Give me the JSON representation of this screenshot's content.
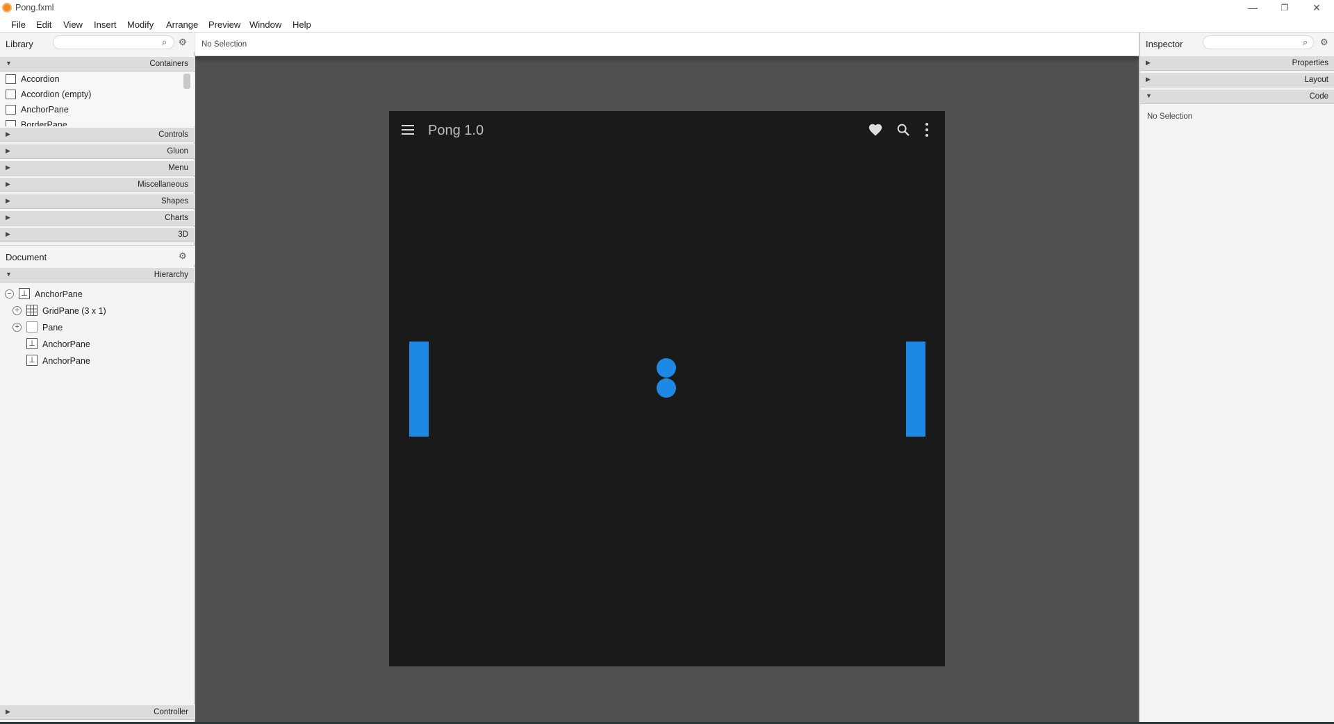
{
  "window": {
    "title": "Pong.fxml",
    "minimize": "—",
    "restore": "❐",
    "close": "✕"
  },
  "menu": [
    "File",
    "Edit",
    "View",
    "Insert",
    "Modify",
    "Arrange",
    "Preview",
    "Window",
    "Help"
  ],
  "library": {
    "title": "Library",
    "search_placeholder": "",
    "sections": [
      "Containers",
      "Controls",
      "Gluon",
      "Menu",
      "Miscellaneous",
      "Shapes",
      "Charts",
      "3D"
    ],
    "container_items": [
      "Accordion",
      "Accordion  (empty)",
      "AnchorPane",
      "BorderPane"
    ]
  },
  "document": {
    "title": "Document",
    "hierarchy_label": "Hierarchy",
    "tree": [
      {
        "label": "AnchorPane",
        "toggle": "−"
      },
      {
        "label": "GridPane (3 x 1)",
        "toggle": "+"
      },
      {
        "label": "Pane",
        "toggle": "+"
      },
      {
        "label": "AnchorPane",
        "toggle": ""
      },
      {
        "label": "AnchorPane",
        "toggle": ""
      }
    ],
    "controller_label": "Controller"
  },
  "center": {
    "selection_text": "No Selection"
  },
  "app": {
    "title": "Pong 1.0",
    "accent_color": "#1e88e5",
    "background_color": "#1a1a1a",
    "icons": [
      "menu-icon",
      "heart-icon",
      "search-icon",
      "more-vert-icon"
    ]
  },
  "inspector": {
    "title": "Inspector",
    "sections": [
      "Properties",
      "Layout",
      "Code"
    ],
    "selection_text": "No Selection"
  }
}
